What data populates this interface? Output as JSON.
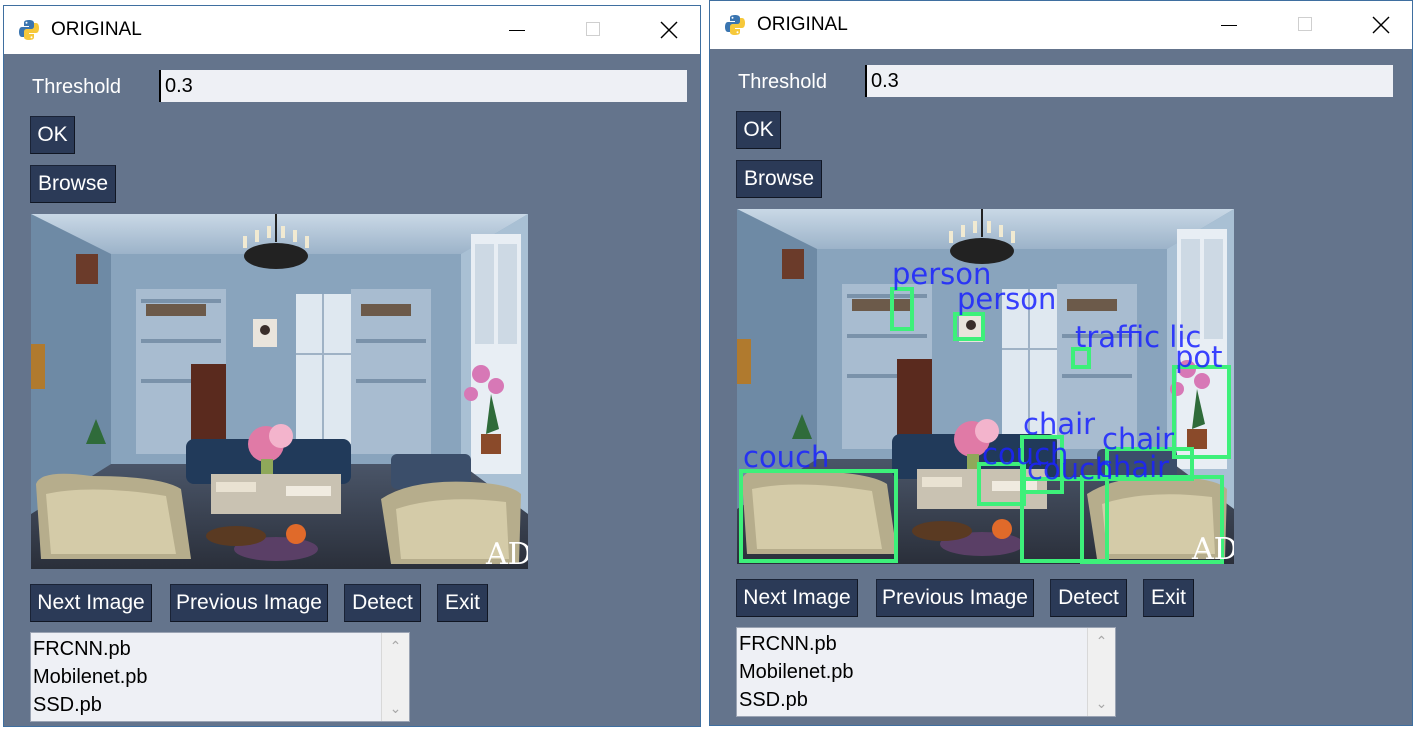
{
  "windows": [
    {
      "title": "ORIGINAL",
      "icon": "python-logo-icon",
      "threshold": {
        "label": "Threshold",
        "value": "0.3"
      },
      "buttons": {
        "ok": "OK",
        "browse": "Browse",
        "next": "Next Image",
        "previous": "Previous Image",
        "detect": "Detect",
        "exit": "Exit"
      },
      "image": {
        "watermark": "AD"
      },
      "models": [
        "FRCNN.pb",
        "Mobilenet.pb",
        "SSD.pb"
      ]
    },
    {
      "title": "ORIGINAL",
      "icon": "python-logo-icon",
      "threshold": {
        "label": "Threshold",
        "value": "0.3"
      },
      "buttons": {
        "ok": "OK",
        "browse": "Browse",
        "next": "Next Image",
        "previous": "Previous Image",
        "detect": "Detect",
        "exit": "Exit"
      },
      "image": {
        "watermark": "AD",
        "detections": [
          {
            "label": "person"
          },
          {
            "label": "person"
          },
          {
            "label": "traffic light"
          },
          {
            "label": "potted plant"
          },
          {
            "label": "chair"
          },
          {
            "label": "chair"
          },
          {
            "label": "chair"
          },
          {
            "label": "couch"
          },
          {
            "label": "couch"
          },
          {
            "label": "couch"
          }
        ]
      },
      "models": [
        "FRCNN.pb",
        "Mobilenet.pb",
        "SSD.pb"
      ]
    }
  ],
  "colors": {
    "window_bg": "#64748c",
    "button_bg": "#2b3a57",
    "entry_bg": "#eef0f5",
    "box_green": "#3df07a",
    "label_blue": "#1a22ff"
  }
}
